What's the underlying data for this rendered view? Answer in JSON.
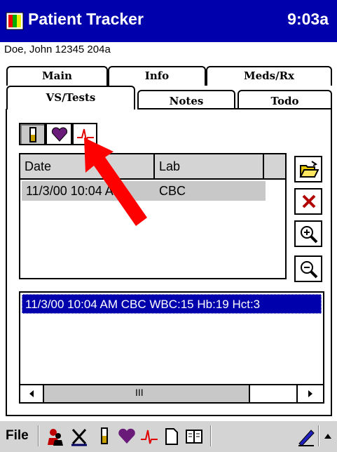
{
  "titlebar": {
    "title": "Patient Tracker",
    "time": "9:03a"
  },
  "patient": {
    "label": "Doe, John 12345 204a"
  },
  "tabs": {
    "back_row": [
      "Main",
      "Info",
      "Meds/Rx"
    ],
    "front_row": [
      "VS/Tests",
      "Notes",
      "Todo"
    ],
    "active": "VS/Tests"
  },
  "list": {
    "columns": [
      "Date",
      "Lab"
    ],
    "rows": [
      {
        "date": "11/3/00 10:04 AM",
        "lab": "CBC"
      }
    ]
  },
  "detail": {
    "text": "11/3/00 10:04 AM CBC WBC:15 Hb:19 Hct:3",
    "scroll_glyph": "III"
  },
  "toolbar": {
    "file_label": "File"
  },
  "colors": {
    "titlebar": "#0000ad",
    "selection": "#0000ad",
    "arrow": "#ff0000"
  }
}
